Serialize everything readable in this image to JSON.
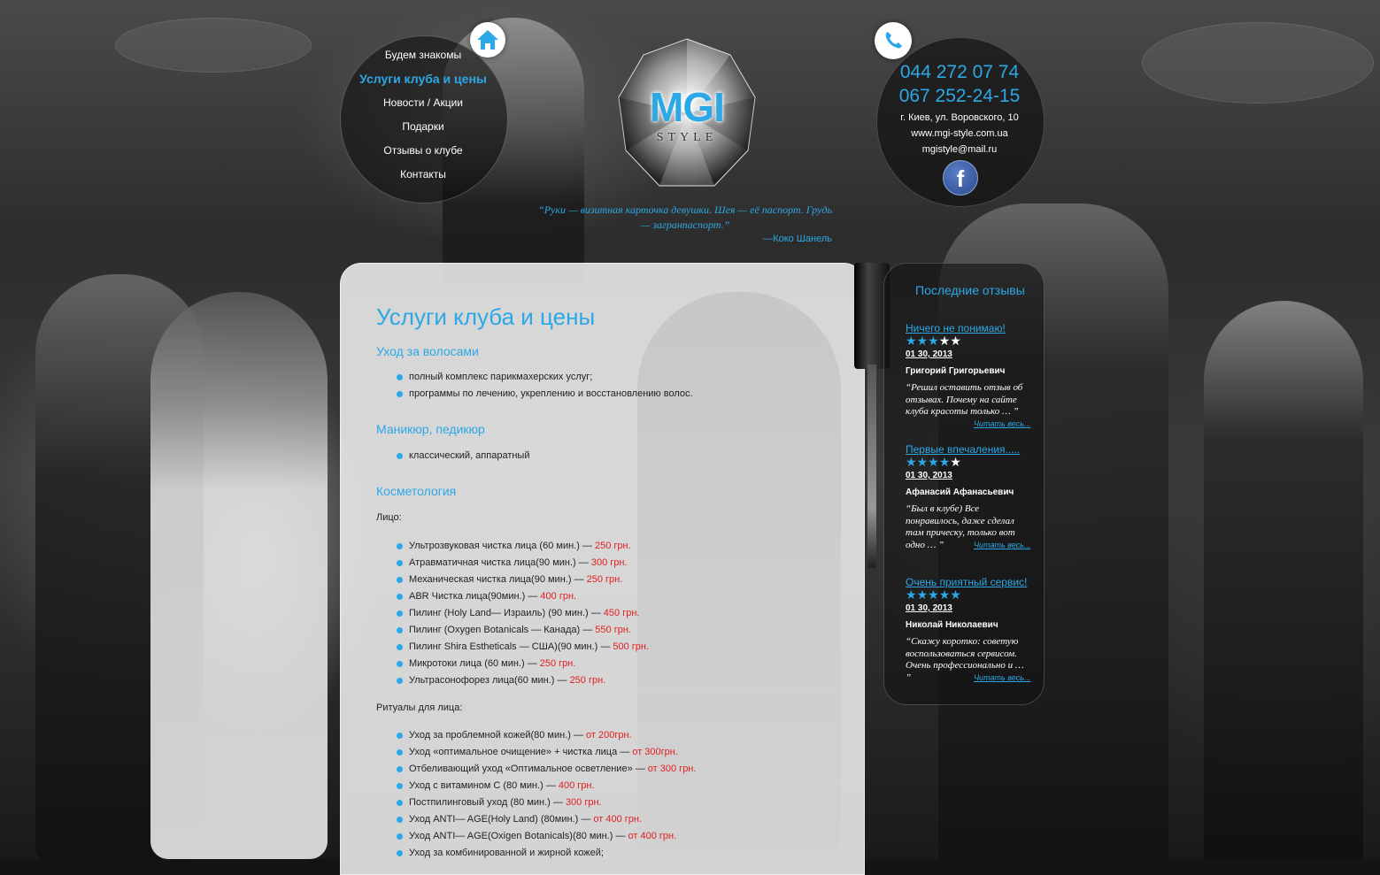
{
  "nav": {
    "items": [
      {
        "label": "Будем знакомы",
        "active": false
      },
      {
        "label": "Услуги клуба и цены",
        "active": true
      },
      {
        "label": "Новости / Акции",
        "active": false
      },
      {
        "label": "Подарки",
        "active": false
      },
      {
        "label": "Отзывы о клубе",
        "active": false
      },
      {
        "label": "Контакты",
        "active": false
      }
    ],
    "home_icon": "home-icon"
  },
  "logo": {
    "main": "MGI",
    "sub": "STYLE"
  },
  "quote": {
    "text": "“Руки — визитная карточка девушки. Шея — её паспорт. Грудь — загранпаспорт.”",
    "author": "—Коко Шанель"
  },
  "contacts": {
    "phone_icon": "phone-icon",
    "phone1": "044 272 07 74",
    "phone2": "067 252-24-15",
    "address": "г. Киев, ул. Воровского, 10",
    "site": "www.mgi-style.com.ua",
    "email": "mgistyle@mail.ru",
    "facebook_icon": "facebook-icon",
    "facebook_letter": "f"
  },
  "main": {
    "title": "Услуги клуба и цены",
    "hair": {
      "heading": "Уход за волосами",
      "items": [
        "полный комплекс парикмахерских услуг;",
        "программы по лечению, укреплению и восстановлению волос."
      ]
    },
    "nails": {
      "heading": "Маникюр, педикюр",
      "items": [
        "классический, аппаратный"
      ]
    },
    "cosmetology": {
      "heading": "Косметология",
      "face_label": "Лицо:",
      "face_items": [
        {
          "name": "Ультрозвуковая чистка лица (60 мин.) — ",
          "price": "250 грн."
        },
        {
          "name": "Атравматичная чистка лица(90 мин.) — ",
          "price": "300 грн."
        },
        {
          "name": "Механическая чистка лица(90 мин.) — ",
          "price": "250 грн."
        },
        {
          "name": "ABR Чистка лица(90мин.) — ",
          "price": "400 грн."
        },
        {
          "name": "Пилинг (Holy Land— Израиль) (90 мин.) — ",
          "price": "450 грн."
        },
        {
          "name": "Пилинг (Oxygen Botanicals — Канада) — ",
          "price": "550 грн."
        },
        {
          "name": "Пилинг Shira Esthеticals — США)(90 мин.) — ",
          "price": "500 грн."
        },
        {
          "name": "Микротоки лица (60 мин.) — ",
          "price": "250 грн."
        },
        {
          "name": "Ультрасонофорез лица(60 мин.) — ",
          "price": "250 грн."
        }
      ],
      "rituals_label": "Ритуалы для лица:",
      "ritual_items": [
        {
          "name": "Уход за проблемной кожей(80 мин.) — ",
          "price": "от 200грн."
        },
        {
          "name": "Уход «оптимальное очищение» + чистка лица — ",
          "price": "от 300грн."
        },
        {
          "name": "Отбеливающий уход «Оптимальное осветление» — ",
          "price": "от 300 грн."
        },
        {
          "name": "Уход с витамином С (80 мин.) — ",
          "price": "400 грн."
        },
        {
          "name": "Постпилинговый уход (80 мин.) — ",
          "price": "300 грн."
        },
        {
          "name": "Уход ANTI— AGE(Holy Land) (80мин.) — ",
          "price": "от 400 грн."
        },
        {
          "name": "Уход ANTI— AGE(Oxigen Botanicals)(80 мин.) — ",
          "price": "от 400 грн."
        },
        {
          "name": "Уход за комбинированной и жирной кожей;",
          "price": ""
        }
      ]
    }
  },
  "reviews": {
    "title": "Последние отзывы",
    "more_label": "Читать весь...",
    "items": [
      {
        "title": "Ничего не понимаю!",
        "rating": 3,
        "date": "01 30, 2013",
        "author": "Григорий Григорьевич",
        "text": "“Решил оставить отзыв об отзывах. Почему на сайте клуба красоты только … ”"
      },
      {
        "title": "Первые впечаления.....",
        "rating": 4,
        "date": "01 30, 2013",
        "author": "Афанасий Афанасьевич",
        "text": "“Был в клубе) Все понравилось, даже сделал там прическу, только вот одно … ”"
      },
      {
        "title": "Очень приятный сервис!",
        "rating": 5,
        "date": "01 30, 2013",
        "author": "Николай Николаевич",
        "text": "“Скажу коротко: советую воспользоваться сервисом. Очень профессионально и … ”"
      }
    ]
  },
  "colors": {
    "accent": "#2ca8e6",
    "price": "#e02020"
  }
}
